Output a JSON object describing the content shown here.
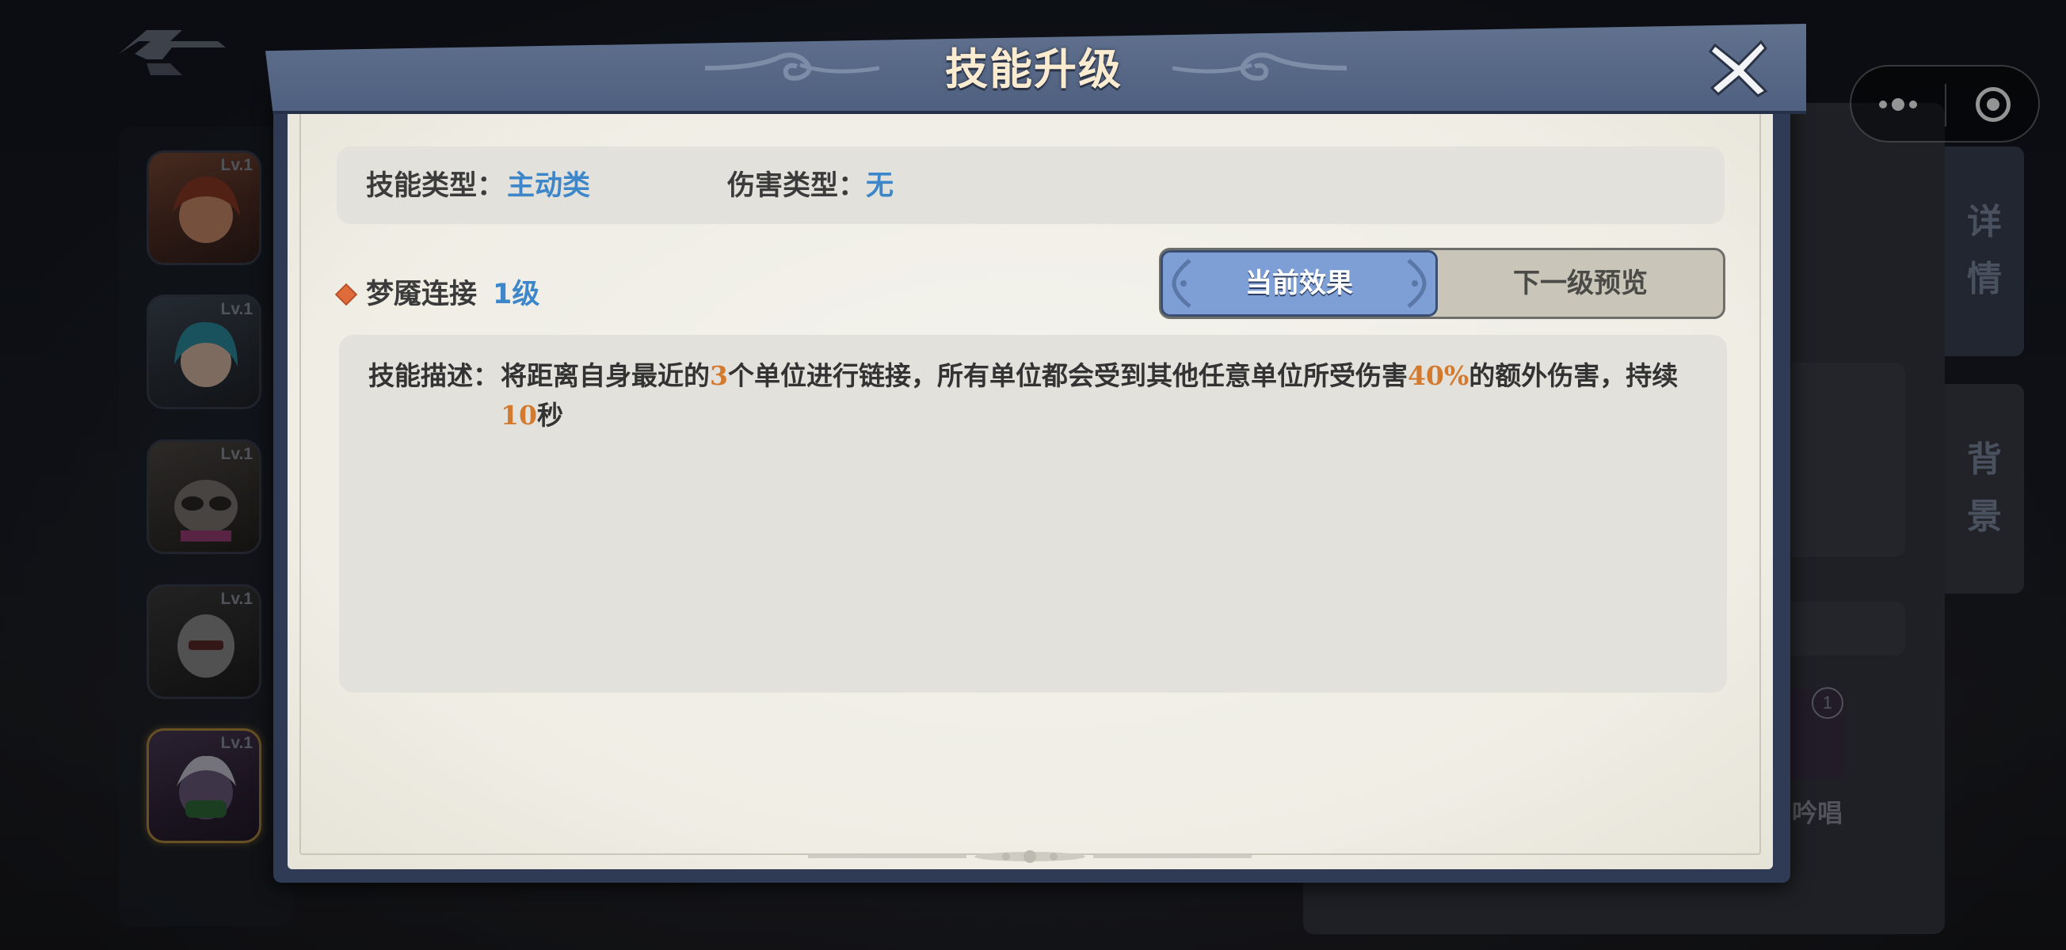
{
  "dialog": {
    "title": "技能升级",
    "skill_type_label": "技能类型：",
    "skill_type_value": "主动类",
    "damage_type_label": "伤害类型：",
    "damage_type_value": "无",
    "skill_name": "梦魇连接",
    "skill_level": "1级",
    "tabs": [
      {
        "label": "当前效果",
        "active": true
      },
      {
        "label": "下一级预览",
        "active": false
      }
    ],
    "description_label": "技能描述：",
    "description": {
      "p1": "将距离自身最近的",
      "n1": "3",
      "p2": "个单位进行链接，所有单位都会受到其他任意单位所受伤害",
      "n2": "40%",
      "p3": "的额外伤害，持续",
      "n3": "10",
      "p4": "秒"
    },
    "highlight_color": "#d37a2e",
    "accent_color": "#3c86c9"
  },
  "heroes": [
    {
      "level": "Lv.1",
      "selected": false,
      "icon": "hero-portrait-girl-icon"
    },
    {
      "level": "Lv.1",
      "selected": false,
      "icon": "hero-portrait-blue-hair-icon"
    },
    {
      "level": "Lv.1",
      "selected": false,
      "icon": "hero-portrait-raccoon-icon"
    },
    {
      "level": "Lv.1",
      "selected": false,
      "icon": "hero-portrait-robot-icon"
    },
    {
      "level": "Lv.1",
      "selected": true,
      "icon": "hero-portrait-masked-icon"
    }
  ],
  "side_tabs": [
    {
      "label_1": "详",
      "label_2": "情"
    },
    {
      "label_1": "背",
      "label_2": "景"
    }
  ],
  "background_snippets": {
    "skill_badge_count": "1",
    "skill_caption": "吟唱"
  }
}
